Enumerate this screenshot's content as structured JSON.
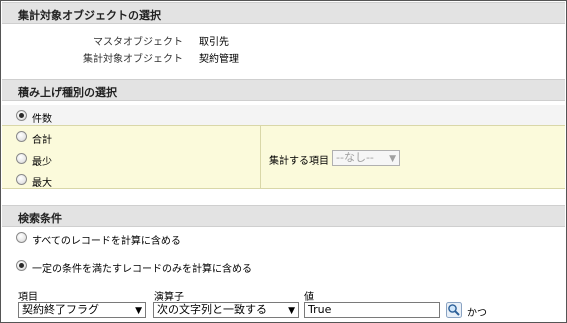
{
  "section1": {
    "title": "集計対象オブジェクトの選択",
    "master_label": "マスタオブジェクト",
    "master_value": "取引先",
    "target_label": "集計対象オブジェクト",
    "target_value": "契約管理"
  },
  "section2": {
    "title": "積み上げ種別の選択",
    "options": [
      {
        "label": "件数",
        "checked": true
      },
      {
        "label": "合計",
        "checked": false
      },
      {
        "label": "最少",
        "checked": false
      },
      {
        "label": "最大",
        "checked": false
      }
    ],
    "field_label": "集計する項目",
    "field_select": "--なし--"
  },
  "section3": {
    "title": "検索条件",
    "option_all": "すべてのレコードを計算に含める",
    "option_filter": "一定の条件を満たすレコードのみを計算に含める",
    "col_field": "項目",
    "col_operator": "演算子",
    "col_value": "値",
    "field_select": "契約終了フラグ",
    "operator_select": "次の文字列と一致する",
    "value_input": "True",
    "and_label": "かつ"
  }
}
